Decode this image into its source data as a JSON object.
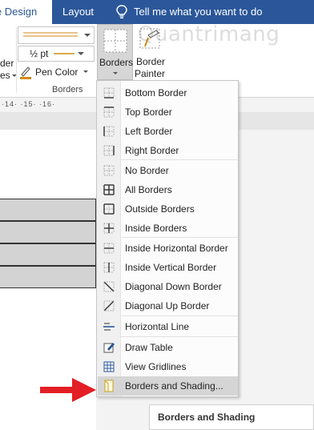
{
  "ribbon_tabs": {
    "design_partial": "le Design",
    "layout": "Layout",
    "tell_me": "Tell me what you want to do"
  },
  "ribbon": {
    "left_labels": [
      "der",
      "es"
    ],
    "pen_weight": "½ pt",
    "pen_color": "Pen Color",
    "group_label": "Borders",
    "borders_button": "Borders",
    "border_painter_line1": "Border",
    "border_painter_line2": "Painter",
    "ruler_text": "·14·  ·15·  ·16·"
  },
  "watermark": "Quantrimang",
  "menu": {
    "items": [
      {
        "label": "Bottom Border",
        "icon": "bottom-border-icon"
      },
      {
        "label": "Top Border",
        "icon": "top-border-icon"
      },
      {
        "label": "Left Border",
        "icon": "left-border-icon"
      },
      {
        "label": "Right Border",
        "icon": "right-border-icon"
      },
      {
        "label": "No Border",
        "icon": "no-border-icon"
      },
      {
        "label": "All Borders",
        "icon": "all-borders-icon"
      },
      {
        "label": "Outside Borders",
        "icon": "outside-borders-icon"
      },
      {
        "label": "Inside Borders",
        "icon": "inside-borders-icon"
      },
      {
        "label": "Inside Horizontal Border",
        "icon": "inside-horizontal-border-icon"
      },
      {
        "label": "Inside Vertical Border",
        "icon": "inside-vertical-border-icon"
      },
      {
        "label": "Diagonal Down Border",
        "icon": "diagonal-down-border-icon"
      },
      {
        "label": "Diagonal Up Border",
        "icon": "diagonal-up-border-icon"
      },
      {
        "label": "Horizontal Line",
        "icon": "horizontal-line-icon"
      },
      {
        "label": "Draw Table",
        "icon": "draw-table-icon"
      },
      {
        "label": "View Gridlines",
        "icon": "view-gridlines-icon"
      },
      {
        "label": "Borders and Shading...",
        "icon": "borders-and-shading-icon"
      }
    ]
  },
  "tooltip": {
    "title": "Borders and Shading"
  },
  "colors": {
    "ribbon_blue": "#2b579a",
    "arrow_red": "#e31e24",
    "pen_orange": "#d48a1a",
    "highlight": "#d5d5d5"
  }
}
